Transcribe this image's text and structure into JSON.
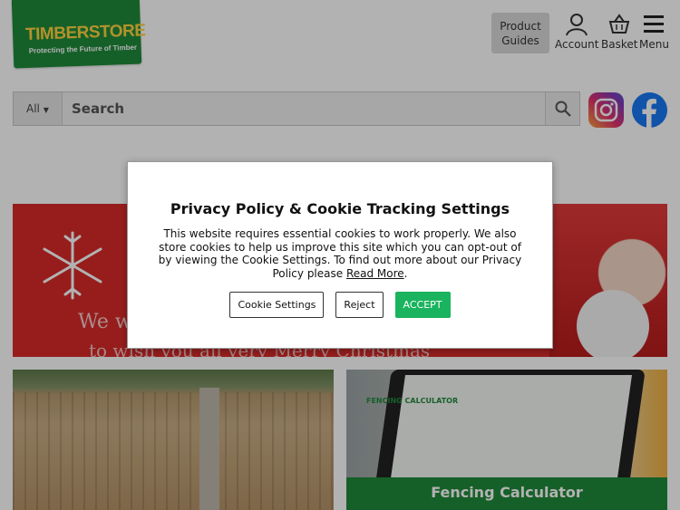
{
  "header": {
    "logo_name": "TIMBERSTORE",
    "logo_tagline": "Protecting the Future of Timber",
    "product_guides_label": "Product Guides",
    "account_label": "Account",
    "basket_label": "Basket",
    "menu_label": "Menu"
  },
  "search": {
    "category": "All",
    "placeholder": "Search"
  },
  "social": {
    "instagram": "instagram-icon",
    "facebook": "facebook-icon"
  },
  "banner": {
    "line1": "We w",
    "line2": "to wish you all very Merry Christmas"
  },
  "tiles": {
    "calculator_caption": "Fencing Calculator",
    "screen_title": "FENCING CALCULATOR"
  },
  "cookie_modal": {
    "title": "Privacy Policy & Cookie Tracking Settings",
    "body": "This website requires essential cookies to work properly. We also store cookies to help us improve this site which you can opt-out of by viewing the Cookie Settings. To find out more about our Privacy Policy please ",
    "read_more": "Read More",
    "settings_button": "Cookie Settings",
    "reject_button": "Reject",
    "accept_button": "ACCEPT"
  },
  "colors": {
    "brand_green": "#1f8a3a",
    "accept_green": "#1ab35e",
    "banner_red": "#d82a2a"
  }
}
